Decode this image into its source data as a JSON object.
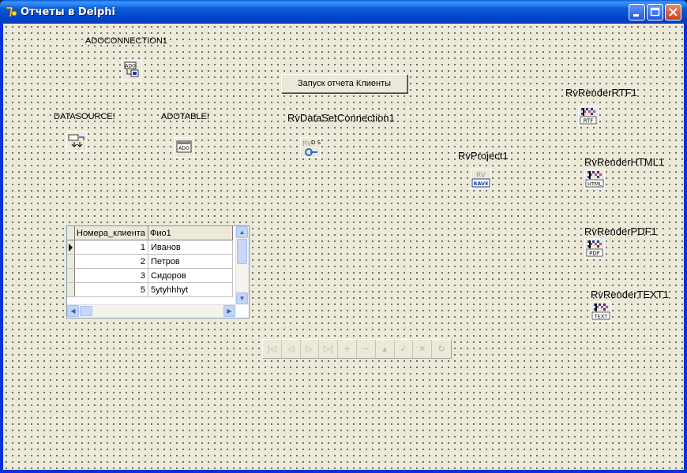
{
  "window": {
    "title": "Отчеты в Delphi"
  },
  "components": {
    "adoconnection": "ADOCONNECTION1",
    "datasource": "DATASOURCE!",
    "adotable": "ADOTABLE!",
    "rvdataset": "RvDataSetConnection1",
    "rvproject": "RvProject1",
    "rtf": "RvRenderRTF1",
    "html": "RvRenderHTML1",
    "pdf": "RvRenderPDF1",
    "text": "RvRenderTEXT1"
  },
  "icons": {
    "ado": "ADO",
    "adotable": "ADO",
    "rv": "RV",
    "ds": "D S",
    "rave": "RAVE",
    "rtf": "RTF",
    "html": "HTML",
    "pdf": "PDF",
    "text": "TEXT"
  },
  "button": {
    "label": "Запуск отчета Клиенты"
  },
  "grid": {
    "columns": [
      "Номера_клиента",
      "Фио1"
    ],
    "rows": [
      {
        "num": "1",
        "name": "Иванов"
      },
      {
        "num": "2",
        "name": "Петров"
      },
      {
        "num": "3",
        "name": "Сидоров"
      },
      {
        "num": "5",
        "name": "5ytyhhhyt"
      }
    ]
  },
  "navigator": {
    "buttons": [
      "first-icon",
      "prior-icon",
      "next-icon",
      "last-icon",
      "insert-icon",
      "delete-icon",
      "edit-icon",
      "post-icon",
      "cancel-icon",
      "refresh-icon"
    ]
  },
  "colors": {
    "title_bar": "#0a5fd8",
    "form": "#ece9d8"
  }
}
